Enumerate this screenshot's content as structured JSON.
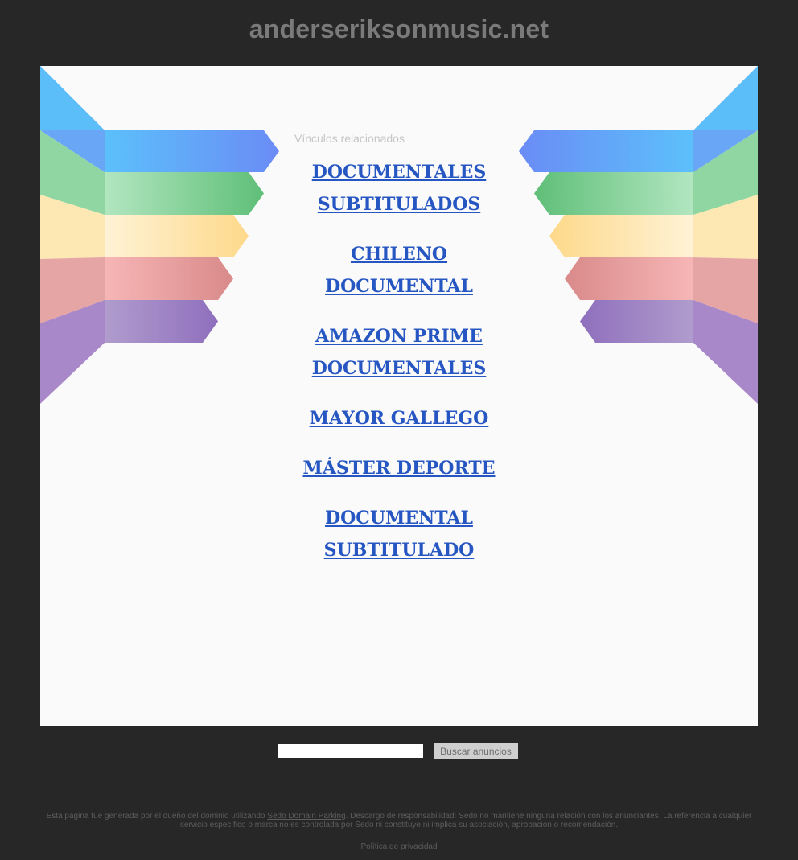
{
  "header": {
    "domain": "anderseriksonmusic.net"
  },
  "main": {
    "related_heading": "Vínculos relacionados",
    "links": [
      {
        "line1": "DOCUMENTALES",
        "line2": "SUBTITULADOS"
      },
      {
        "line1": "CHILENO",
        "line2": "DOCUMENTAL"
      },
      {
        "line1": "AMAZON PRIME",
        "line2": "DOCUMENTALES"
      },
      {
        "line1": "MAYOR GALLEGO",
        "line2": ""
      },
      {
        "line1": "MÁSTER DEPORTE",
        "line2": ""
      },
      {
        "line1": "DOCUMENTAL",
        "line2": "SUBTITULADO"
      }
    ]
  },
  "search": {
    "value": "",
    "button_label": "Buscar anuncios"
  },
  "footer": {
    "text_before_link": "Esta página fue generada por el dueño del dominio utilizando ",
    "link_label": "Sedo Domain Parking",
    "text_after_link": ". Descargo de responsabilidad: Sedo no mantiene ninguna relación con los anunciantes. La referencia a cualquier servicio específico o marca no es controlada por Sedo ni constituye ni implica su asociación, aprobación o recomendación.",
    "privacy_label": "Política de privacidad"
  },
  "colors": {
    "page_background": "#272727",
    "panel_background": "#fafafa",
    "link": "#2656c2",
    "ribbon_blue": "#6fb7f8",
    "ribbon_green": "#7fcf93",
    "ribbon_yellow": "#fde3a0",
    "ribbon_red": "#e79c9c",
    "ribbon_purple": "#a283c4"
  }
}
